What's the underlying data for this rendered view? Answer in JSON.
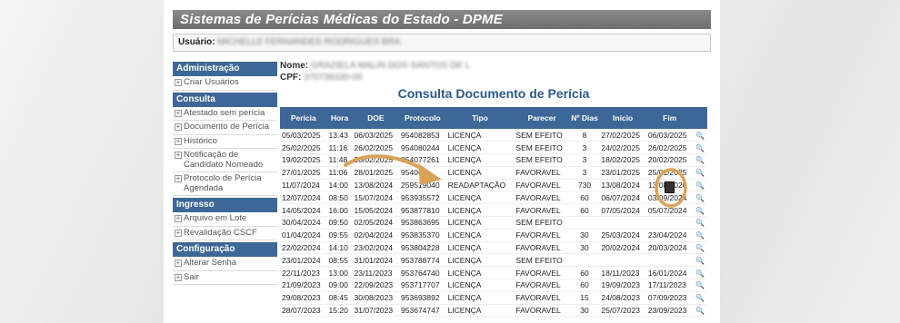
{
  "header": {
    "title": "Sistemas de Perícias Médicas do Estado - DPME"
  },
  "user": {
    "label": "Usuário:",
    "value": "MICHELLE FERNANDES RODRIGUES BRA"
  },
  "sidebar": {
    "sections": [
      {
        "title": "Administração",
        "items": [
          "Criar Usuários"
        ]
      },
      {
        "title": "Consulta",
        "items": [
          "Atestado sem perícia",
          "Documento de Perícia",
          "Histórico",
          "Notificação de Candidato Nomeado",
          "Protocolo de Perícia Agendada"
        ]
      },
      {
        "title": "Ingresso",
        "items": [
          "Arquivo em Lote",
          "Revalidação CSCF"
        ]
      },
      {
        "title": "Configuração",
        "items": [
          "Alterar Senha",
          "Sair"
        ]
      }
    ]
  },
  "person": {
    "name_label": "Nome:",
    "name_value": "GRAZIELA MALIN DOS SANTOS DE L",
    "cpf_label": "CPF:",
    "cpf_value": "370739330-00"
  },
  "page_title": "Consulta Documento de Perícia",
  "table": {
    "headers": [
      "Perícia",
      "Hora",
      "DOE",
      "Protocolo",
      "Tipo",
      "Parecer",
      "Nº Dias",
      "Início",
      "Fim",
      ""
    ],
    "rows": [
      [
        "05/03/2025",
        "13:43",
        "06/03/2025",
        "954082853",
        "LICENÇA",
        "SEM EFEITO",
        "8",
        "27/02/2025",
        "06/03/2025"
      ],
      [
        "25/02/2025",
        "11:16",
        "26/02/2025",
        "954080244",
        "LICENÇA",
        "SEM EFEITO",
        "3",
        "24/02/2025",
        "26/02/2025"
      ],
      [
        "19/02/2025",
        "11:48",
        "20/02/2025",
        "954077261",
        "LICENÇA",
        "SEM EFEITO",
        "3",
        "18/02/2025",
        "20/02/2025"
      ],
      [
        "27/01/2025",
        "11:06",
        "28/01/2025",
        "954063",
        "LICENÇA",
        "FAVORAVEL",
        "3",
        "23/01/2025",
        "25/01/2025"
      ],
      [
        "11/07/2024",
        "14:00",
        "13/08/2024",
        "259519040",
        "READAPTAÇÃO",
        "FAVORAVEL",
        "730",
        "13/08/2024",
        "13/08/2026"
      ],
      [
        "12/07/2024",
        "08:50",
        "15/07/2024",
        "953935572",
        "LICENÇA",
        "FAVORAVEL",
        "60",
        "06/07/2024",
        "03/09/2024"
      ],
      [
        "14/05/2024",
        "16:00",
        "15/05/2024",
        "953877810",
        "LICENÇA",
        "FAVORAVEL",
        "60",
        "07/05/2024",
        "05/07/2024"
      ],
      [
        "30/04/2024",
        "09:50",
        "02/05/2024",
        "953863695",
        "LICENÇA",
        "SEM EFEITO",
        "",
        "",
        ""
      ],
      [
        "01/04/2024",
        "09:55",
        "02/04/2024",
        "953835370",
        "LICENÇA",
        "FAVORAVEL",
        "30",
        "25/03/2024",
        "23/04/2024"
      ],
      [
        "22/02/2024",
        "14:10",
        "23/02/2024",
        "953804228",
        "LICENÇA",
        "FAVORAVEL",
        "30",
        "20/02/2024",
        "20/03/2024"
      ],
      [
        "23/01/2024",
        "08:55",
        "31/01/2024",
        "953788774",
        "LICENÇA",
        "SEM EFEITO",
        "",
        "",
        ""
      ],
      [
        "22/11/2023",
        "13:00",
        "23/11/2023",
        "953764740",
        "LICENÇA",
        "FAVORAVEL",
        "60",
        "18/11/2023",
        "16/01/2024"
      ],
      [
        "21/09/2023",
        "09:00",
        "22/09/2023",
        "953717707",
        "LICENÇA",
        "FAVORAVEL",
        "60",
        "19/09/2023",
        "17/11/2023"
      ],
      [
        "29/08/2023",
        "08:45",
        "30/08/2023",
        "953693892",
        "LICENÇA",
        "FAVORAVEL",
        "15",
        "24/08/2023",
        "07/09/2023"
      ],
      [
        "28/07/2023",
        "15:20",
        "31/07/2023",
        "953674747",
        "LICENÇA",
        "FAVORAVEL",
        "30",
        "25/07/2023",
        "23/09/2023"
      ]
    ]
  },
  "colors": {
    "accent": "#3d6796",
    "highlight": "#d9a35a"
  }
}
